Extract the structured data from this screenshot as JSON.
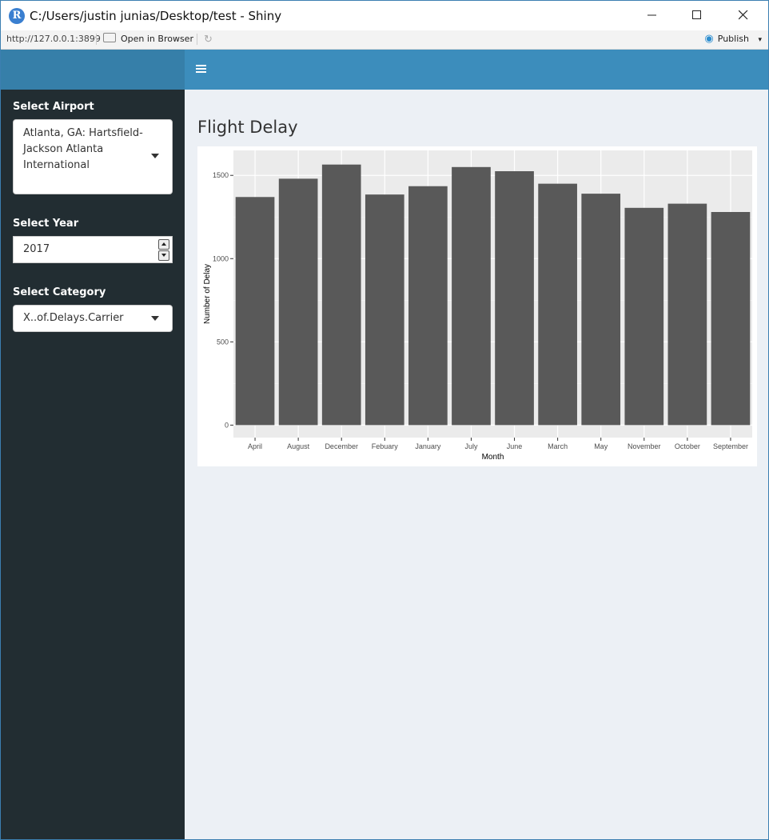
{
  "window": {
    "title": "C:/Users/justin junias/Desktop/test - Shiny",
    "r_logo": "R"
  },
  "toolbar": {
    "url": "http://127.0.0.1:3899",
    "open_in_browser": "Open in Browser",
    "publish": "Publish",
    "publish_caret": "▾"
  },
  "header": {
    "menu_icon": "hamburger-icon"
  },
  "sidebar": {
    "airport_label": "Select Airport",
    "airport_value_lines": [
      "Atlanta, GA: Hartsfield-",
      "Jackson Atlanta",
      "International"
    ],
    "year_label": "Select Year",
    "year_value": "2017",
    "category_label": "Select Category",
    "category_value": "X..of.Delays.Carrier"
  },
  "main": {
    "title": "Flight Delay"
  },
  "colors": {
    "header": "#3c8dbc",
    "sidebar": "#222d32",
    "bar": "#595959",
    "panel": "#ebebeb"
  },
  "chart_data": {
    "type": "bar",
    "categories": [
      "April",
      "August",
      "December",
      "Febuary",
      "January",
      "July",
      "June",
      "March",
      "May",
      "November",
      "October",
      "September"
    ],
    "values": [
      1370,
      1480,
      1565,
      1385,
      1435,
      1550,
      1525,
      1450,
      1390,
      1305,
      1330,
      1280
    ],
    "xlabel": "Month",
    "ylabel": "Number of Delay",
    "ylim": [
      -75,
      1650
    ],
    "yticks": [
      0,
      500,
      1000,
      1500
    ],
    "grid": true
  }
}
